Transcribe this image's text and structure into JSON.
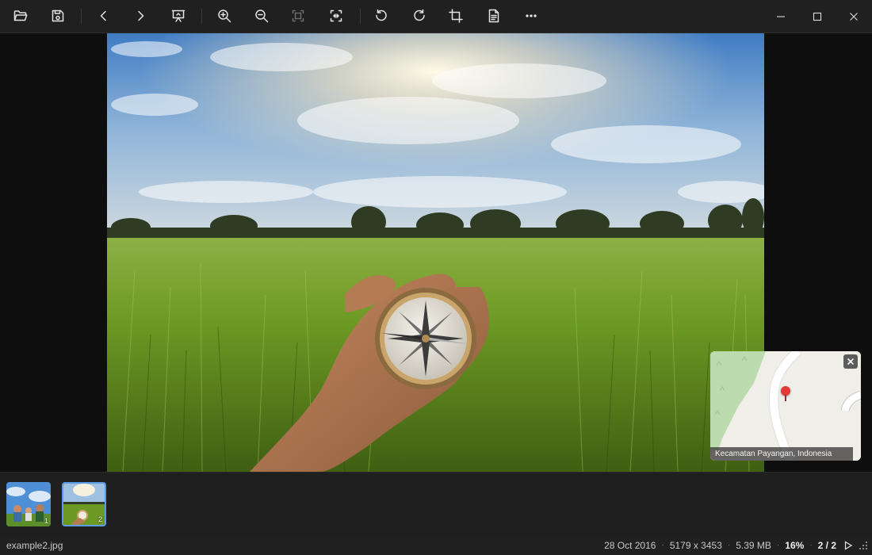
{
  "toolbar": {
    "buttons": [
      {
        "name": "open-folder-icon"
      },
      {
        "name": "save-icon"
      },
      {
        "name": "previous-icon"
      },
      {
        "name": "next-icon"
      },
      {
        "name": "slideshow-icon"
      },
      {
        "name": "zoom-in-icon"
      },
      {
        "name": "zoom-out-icon"
      },
      {
        "name": "actual-size-icon",
        "state": "disabled"
      },
      {
        "name": "fit-to-window-icon"
      },
      {
        "name": "rotate-left-icon"
      },
      {
        "name": "rotate-right-icon"
      },
      {
        "name": "crop-icon"
      },
      {
        "name": "file-info-icon"
      },
      {
        "name": "more-icon"
      }
    ],
    "window_controls": [
      "minimize-icon",
      "maximize-icon",
      "close-icon"
    ]
  },
  "map": {
    "location": "Kecamatan Payangan, Indonesia",
    "pin_color": "#e53935"
  },
  "thumbnails": [
    {
      "index": "1",
      "active": false
    },
    {
      "index": "2",
      "active": true
    }
  ],
  "status": {
    "filename": "example2.jpg",
    "date": "28 Oct 2016",
    "dimensions": "5179 x 3453",
    "filesize": "5.39 MB",
    "zoom": "16%",
    "position": "2 / 2",
    "separator": "·"
  },
  "colors": {
    "accent": "#5a9be6",
    "toolbar_bg": "#202020",
    "viewer_bg": "#0e0e0e"
  }
}
